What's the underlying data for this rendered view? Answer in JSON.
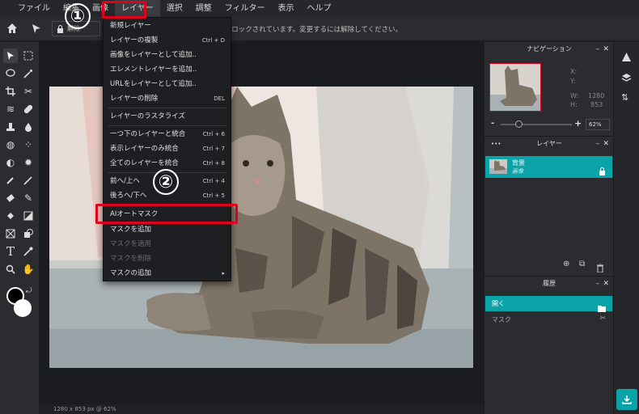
{
  "menubar": {
    "items": [
      "ファイル",
      "編集",
      "画像",
      "レイヤー",
      "選択",
      "調整",
      "フィルター",
      "表示",
      "ヘルプ"
    ]
  },
  "toolbar": {
    "unlock_label": "解除",
    "lock_message": "レイヤーはロックされています。変更するには解除してください。"
  },
  "dropdown": {
    "items": [
      {
        "label": "新規レイヤー",
        "shortcut": ""
      },
      {
        "label": "レイヤーの複製",
        "shortcut": "Ctrl + D"
      },
      {
        "label": "画像をレイヤーとして追加..",
        "shortcut": ""
      },
      {
        "label": "エレメントレイヤーを追加..",
        "shortcut": ""
      },
      {
        "label": "URLをレイヤーとして追加..",
        "shortcut": ""
      },
      {
        "label": "レイヤーの削除",
        "shortcut": "DEL"
      },
      {
        "label": "レイヤーのラスタライズ",
        "shortcut": ""
      },
      {
        "label": "一つ下のレイヤーと統合",
        "shortcut": "Ctrl + 6"
      },
      {
        "label": "表示レイヤーのみ統合",
        "shortcut": "Ctrl + 7"
      },
      {
        "label": "全てのレイヤーを統合",
        "shortcut": "Ctrl + 8"
      },
      {
        "label": "前へ/上へ",
        "shortcut": "Ctrl + 4"
      },
      {
        "label": "後ろへ/下へ",
        "shortcut": "Ctrl + 5"
      },
      {
        "label": "AIオートマスク",
        "shortcut": ""
      },
      {
        "label": "マスクを追加",
        "shortcut": ""
      },
      {
        "label": "マスクを適用",
        "shortcut": ""
      },
      {
        "label": "マスクを削除",
        "shortcut": ""
      },
      {
        "label": "マスクの追加",
        "shortcut": "▸"
      }
    ]
  },
  "annotations": {
    "step1": "①",
    "step2": "②"
  },
  "navigation": {
    "title": "ナビゲーション",
    "x_label": "X:",
    "y_label": "Y:",
    "w_label": "W:",
    "w_value": "1280",
    "h_label": "H:",
    "h_value": "853",
    "zoom_minus": "-",
    "zoom_plus": "+",
    "zoom": "62%"
  },
  "layers": {
    "title": "レイヤー",
    "dots": "•••",
    "item_name": "背景",
    "item_sub": "画像"
  },
  "history": {
    "title": "履歴",
    "items": [
      "開く",
      "マスク"
    ]
  },
  "status": {
    "text": "1280 x 853 px @ 62%"
  },
  "colors": {
    "accent": "#0aa3a8",
    "highlight": "#e0001b"
  }
}
